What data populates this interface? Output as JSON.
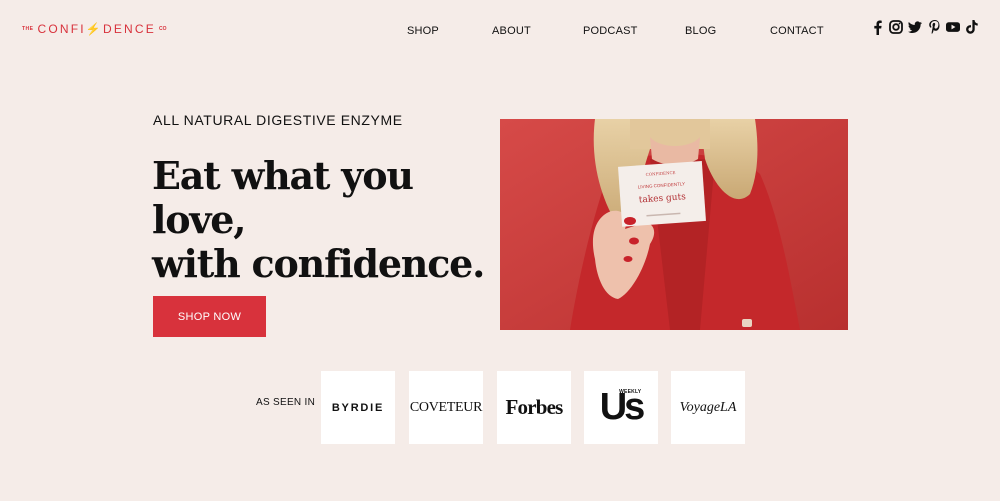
{
  "brand": {
    "prefix": "THE",
    "name": "CONFI⚡DENCE",
    "suffix": "CO",
    "color": "#d8323c"
  },
  "nav": {
    "items": [
      "SHOP",
      "ABOUT",
      "PODCAST",
      "BLOG",
      "CONTACT"
    ]
  },
  "social": [
    "facebook-icon",
    "instagram-icon",
    "twitter-icon",
    "pinterest-icon",
    "youtube-icon",
    "tiktok-icon"
  ],
  "hero": {
    "eyebrow": "ALL NATURAL DIGESTIVE ENZYME",
    "headline_line1": "Eat what you love,",
    "headline_line2": "with confidence.",
    "cta": "SHOP NOW"
  },
  "video": {
    "card_brand": "CONFIDENCE",
    "card_small": "LIVING CONFIDENTLY",
    "card_big": "takes guts"
  },
  "press": {
    "label": "AS SEEN IN",
    "logos": [
      "BYRDIE",
      "COVETEUR",
      "Forbes",
      "Us",
      "VoyageLA"
    ],
    "us_sub": "WEEKLY"
  }
}
